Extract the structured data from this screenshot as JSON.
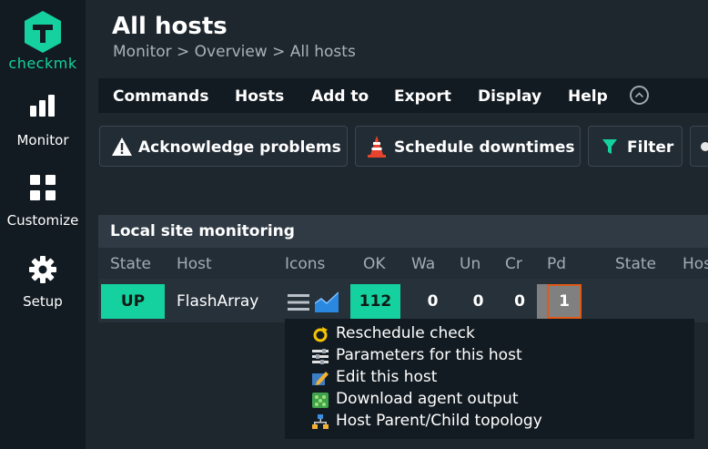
{
  "sidebar": {
    "logo_text": "checkmk",
    "items": [
      {
        "label": "Monitor"
      },
      {
        "label": "Customize"
      },
      {
        "label": "Setup"
      }
    ]
  },
  "header": {
    "title": "All hosts",
    "breadcrumb": "Monitor > Overview > All hosts"
  },
  "menu": {
    "items": [
      "Commands",
      "Hosts",
      "Add to",
      "Export",
      "Display",
      "Help"
    ]
  },
  "toolbar": {
    "acknowledge": "Acknowledge problems",
    "schedule": "Schedule downtimes",
    "filter": "Filter"
  },
  "table": {
    "site_title": "Local site monitoring",
    "columns": [
      "State",
      "Host",
      "Icons",
      "OK",
      "Wa",
      "Un",
      "Cr",
      "Pd",
      "State",
      "Hos"
    ],
    "rows": [
      {
        "state": "UP",
        "host": "FlashArray",
        "ok": "112",
        "wa": "0",
        "un": "0",
        "cr": "0",
        "pd": "1"
      }
    ]
  },
  "context_menu": {
    "items": [
      {
        "label": "Reschedule check",
        "icon": "reschedule-icon"
      },
      {
        "label": "Parameters for this host",
        "icon": "parameters-icon"
      },
      {
        "label": "Edit this host",
        "icon": "edit-icon"
      },
      {
        "label": "Download agent output",
        "icon": "download-agent-icon"
      },
      {
        "label": "Host Parent/Child topology",
        "icon": "topology-icon"
      }
    ]
  },
  "colors": {
    "accent": "#15d1a0",
    "ok_bg": "#15d1a0",
    "up_bg": "#15d1a0",
    "pending_bg": "#808080",
    "highlight_border": "#e05a1a"
  }
}
